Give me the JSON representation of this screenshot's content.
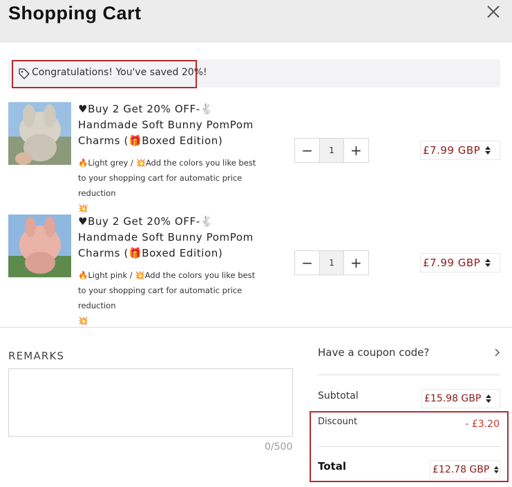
{
  "header": {
    "title": "Shopping Cart",
    "close_icon": "close-icon"
  },
  "banner": {
    "icon": "tag-icon",
    "text": "Congratulations! You've saved 20%!"
  },
  "items": [
    {
      "image": "grey-bunny-pompom-photo",
      "title_line1": "Buy 2 Get 20% OFF-",
      "title_line2": "Handmade Soft Bunny PomPom",
      "title_line3_pre": "Charms  (",
      "title_line3_post": "Boxed Edition)",
      "desc_variant": "Light grey / ",
      "desc_text": "Add the colors you like best to your shopping cart for automatic price reduction",
      "quantity": "1",
      "price": "£7.99 GBP"
    },
    {
      "image": "pink-bunny-pompom-photo",
      "title_line1": "Buy 2 Get 20% OFF-",
      "title_line2": "Handmade Soft Bunny PomPom",
      "title_line3_pre": "Charms  (",
      "title_line3_post": "Boxed Edition)",
      "desc_variant": "Light pink / ",
      "desc_text": "Add the colors you like best to your shopping cart for automatic price reduction",
      "quantity": "1",
      "price": "£7.99 GBP"
    }
  ],
  "remarks": {
    "label": "REMARKS",
    "value": "",
    "counter": "0/500"
  },
  "summary": {
    "coupon_label": "Have a coupon code?",
    "subtotal_label": "Subtotal",
    "subtotal_value": "£15.98 GBP",
    "discount_label": "Discount",
    "discount_value": "- £3.20",
    "total_label": "Total",
    "total_value": "£12.78 GBP"
  },
  "colors": {
    "accent": "#8b1a1a",
    "highlight_border": "#b7282e",
    "header_bg": "#ececec"
  }
}
